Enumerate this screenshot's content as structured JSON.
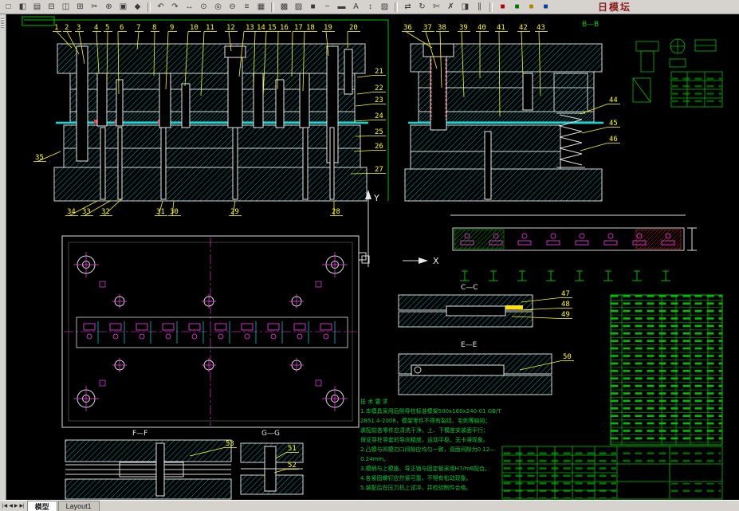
{
  "toolbar": {
    "brand_text": "日模坛",
    "groups": [
      [
        {
          "name": "new-file",
          "glyph": "□"
        },
        {
          "name": "open-file",
          "glyph": "◧"
        },
        {
          "name": "save-file",
          "glyph": "▤"
        },
        {
          "name": "plot",
          "glyph": "⊟"
        },
        {
          "name": "plot-preview",
          "glyph": "◫"
        },
        {
          "name": "publish",
          "glyph": "⊞"
        },
        {
          "name": "cut",
          "glyph": "✂"
        },
        {
          "name": "copy",
          "glyph": "⊕"
        },
        {
          "name": "paste",
          "glyph": "▣"
        },
        {
          "name": "match-properties",
          "glyph": "◆"
        }
      ],
      [
        {
          "name": "undo",
          "glyph": "↶"
        },
        {
          "name": "redo",
          "glyph": "↷"
        },
        {
          "name": "pan",
          "glyph": "↔"
        },
        {
          "name": "zoom-realtime",
          "glyph": "⊙"
        },
        {
          "name": "zoom-window",
          "glyph": "◎"
        },
        {
          "name": "zoom-previous",
          "glyph": "⊖"
        },
        {
          "name": "properties",
          "glyph": "≡"
        },
        {
          "name": "designcenter",
          "glyph": "▦"
        }
      ],
      [
        {
          "name": "layers",
          "glyph": "▩"
        },
        {
          "name": "layer-properties",
          "glyph": "▨"
        },
        {
          "name": "color-control",
          "glyph": "■"
        },
        {
          "name": "linetype",
          "glyph": "−"
        },
        {
          "name": "lineweight",
          "glyph": "▬"
        },
        {
          "name": "text-style",
          "glyph": "A"
        },
        {
          "name": "dimension",
          "glyph": "↕"
        },
        {
          "name": "hatch",
          "glyph": "▧"
        }
      ],
      [
        {
          "name": "move",
          "glyph": "⇄"
        },
        {
          "name": "rotate",
          "glyph": "↻"
        },
        {
          "name": "trim",
          "glyph": "✄"
        },
        {
          "name": "erase",
          "glyph": "✗"
        },
        {
          "name": "mirror",
          "glyph": "◨"
        },
        {
          "name": "offset",
          "glyph": "∥"
        }
      ],
      [
        {
          "name": "custom-tool-1",
          "glyph": "■",
          "color": "#b00000"
        },
        {
          "name": "custom-tool-2",
          "glyph": "■",
          "color": "#007800"
        },
        {
          "name": "custom-tool-3",
          "glyph": "■",
          "color": "#b08800"
        },
        {
          "name": "custom-tool-4",
          "glyph": "■",
          "color": "#0040a0"
        }
      ]
    ]
  },
  "canvas": {
    "colors": {
      "background": "#000000",
      "geometry": "#dcdcdc",
      "hatch": "#00a6ad",
      "leaders": "#ffff00",
      "tables": "#00c000",
      "centerlines": "#ff3df0"
    },
    "balloons": {
      "tl_top": [
        "1",
        "2",
        "3",
        "4",
        "5",
        "6",
        "7",
        "8",
        "9",
        "10",
        "11",
        "12",
        "13",
        "14",
        "15",
        "16",
        "17",
        "18",
        "19",
        "20"
      ],
      "tl_right": [
        "21",
        "22",
        "23",
        "24",
        "25",
        "26",
        "27"
      ],
      "tl_left": [
        "35"
      ],
      "tl_bottom": [
        "34",
        "33",
        "32",
        "31",
        "30",
        "29",
        "28"
      ],
      "tr_top": [
        "36",
        "37",
        "38",
        "39",
        "40",
        "41",
        "42",
        "43"
      ],
      "tr_right": [
        "44",
        "45",
        "46"
      ],
      "detail_cc": [
        "47",
        "48",
        "49"
      ],
      "detail_ee": [
        "50"
      ],
      "detail_ff": [
        "53"
      ],
      "detail_gg": [
        "51",
        "52"
      ]
    },
    "axis": {
      "x": "X",
      "y": "Y"
    },
    "section_labels": {
      "bb": "B—B",
      "cc": "C—C",
      "ee": "E—E",
      "ff": "F—F",
      "gg": "G—G"
    },
    "notes": {
      "lines": [
        "技 术 要 求",
        "1.本模具采用后侧导柱标准模架500x160x240-01 GB/T",
        "2851.4-2008，模架零件不得有裂纹、毛刺等缺陷；",
        "装配前各零件应清洗干净，上、下模座安装面平行；",
        "保证导柱导套的导向精度，运动平稳，无卡滞现象。",
        "2.凸模与凹模刃口间隙应均匀一致，双面间隙为0.12—",
        "0.24mm。",
        "3.模柄与上模座、导正销与固定板采用H7/m6配合。",
        "4.各紧固螺钉应拧紧可靠，不得有松动现象。",
        "5.装配后在压力机上试冲，并检验制件合格。"
      ]
    }
  },
  "statusbar": {
    "nav": [
      "|◀",
      "◀",
      "▶",
      "▶|"
    ],
    "tabs": [
      {
        "label": "模型",
        "active": true
      },
      {
        "label": "Layout1",
        "active": false
      }
    ]
  }
}
